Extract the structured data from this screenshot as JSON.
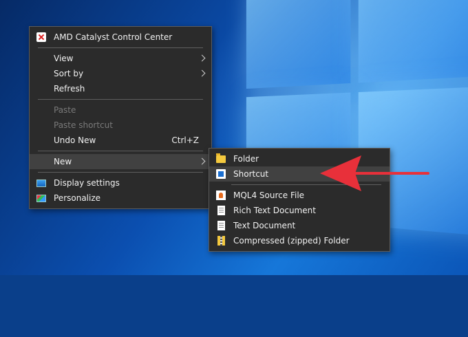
{
  "main_menu": {
    "items": [
      {
        "label": "AMD Catalyst Control Center",
        "icon": "amd-icon"
      },
      {
        "label": "View",
        "submenu": true
      },
      {
        "label": "Sort by",
        "submenu": true
      },
      {
        "label": "Refresh"
      },
      {
        "label": "Paste",
        "disabled": true
      },
      {
        "label": "Paste shortcut",
        "disabled": true
      },
      {
        "label": "Undo New",
        "shortcut": "Ctrl+Z"
      },
      {
        "label": "New",
        "submenu": true,
        "highlighted": true
      },
      {
        "label": "Display settings",
        "icon": "display-settings-icon"
      },
      {
        "label": "Personalize",
        "icon": "personalize-icon"
      }
    ]
  },
  "new_submenu": {
    "items": [
      {
        "label": "Folder",
        "icon": "folder-icon"
      },
      {
        "label": "Shortcut",
        "icon": "shortcut-icon",
        "highlighted": true
      },
      {
        "label": "MQL4 Source File",
        "icon": "mql4-file-icon"
      },
      {
        "label": "Rich Text Document",
        "icon": "rich-text-document-icon"
      },
      {
        "label": "Text Document",
        "icon": "text-document-icon"
      },
      {
        "label": "Compressed (zipped) Folder",
        "icon": "zip-folder-icon"
      }
    ]
  },
  "colors": {
    "menu_bg": "#2b2b2b",
    "highlight": "#414141",
    "arrow": "#e8303a"
  }
}
